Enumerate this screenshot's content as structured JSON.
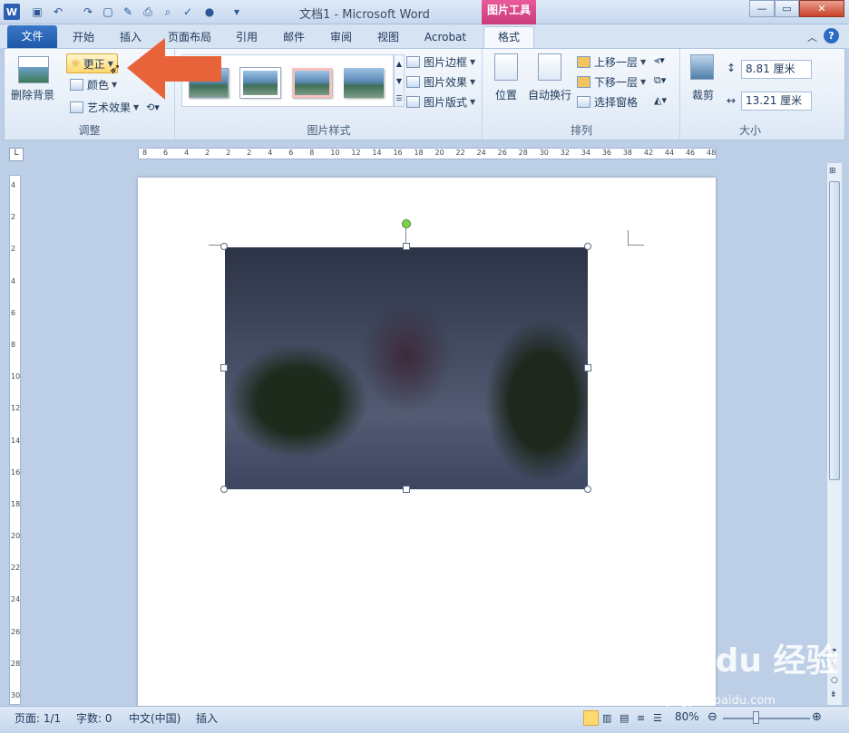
{
  "title_bar": {
    "title": "文档1 - Microsoft Word",
    "tool_context": "图片工具"
  },
  "tabs": [
    {
      "label": "文件"
    },
    {
      "label": "开始"
    },
    {
      "label": "插入"
    },
    {
      "label": "页面布局"
    },
    {
      "label": "引用"
    },
    {
      "label": "邮件"
    },
    {
      "label": "审阅"
    },
    {
      "label": "视图"
    },
    {
      "label": "Acrobat"
    },
    {
      "label": "格式"
    }
  ],
  "ribbon": {
    "adjust": {
      "remove_bg": "删除背景",
      "corrections": "更正",
      "color": "颜色",
      "art_effects": "艺术效果",
      "group_label": "调整"
    },
    "styles": {
      "border": "图片边框",
      "effects": "图片效果",
      "layout": "图片版式",
      "group_label": "图片样式"
    },
    "arrange": {
      "position": "位置",
      "wrap": "自动换行",
      "bring_forward": "上移一层",
      "send_backward": "下移一层",
      "selection_pane": "选择窗格",
      "group_label": "排列"
    },
    "size": {
      "crop": "裁剪",
      "height": "8.81 厘米",
      "width": "13.21 厘米",
      "group_label": "大小"
    }
  },
  "ruler": {
    "h_ticks": [
      "8",
      "6",
      "4",
      "2",
      "2",
      "2",
      "4",
      "6",
      "8",
      "10",
      "12",
      "14",
      "16",
      "18",
      "20",
      "22",
      "24",
      "26",
      "28",
      "30",
      "32",
      "34",
      "36",
      "38",
      "42",
      "44",
      "46",
      "48"
    ],
    "v_ticks": [
      "4",
      "2",
      "2",
      "4",
      "6",
      "8",
      "10",
      "12",
      "14",
      "16",
      "18",
      "20",
      "22",
      "24",
      "26",
      "28",
      "30"
    ]
  },
  "status": {
    "page": "页面: 1/1",
    "words": "字数: 0",
    "lang": "中文(中国)",
    "mode": "插入",
    "zoom": "80%"
  },
  "watermark": {
    "brand": "Bai du 经验",
    "url": "jingyan.baidu.com"
  },
  "colors": {
    "accent": "#2b5fb4",
    "tool_tab": "#d9468a",
    "arrow": "#e8633a"
  }
}
